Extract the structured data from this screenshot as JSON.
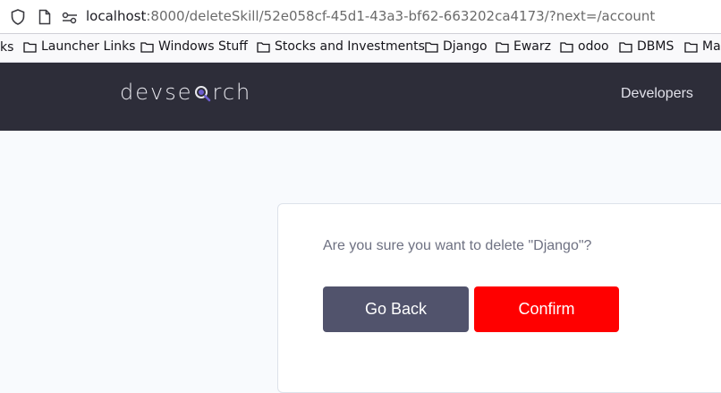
{
  "browser": {
    "url_host": "localhost",
    "url_rest": ":8000/deleteSkill/52e058cf-45d1-43a3-bf62-663202ca4173/?next=/account"
  },
  "bookmarks": {
    "lead_fragment": "ks",
    "items": [
      {
        "label": "Launcher Links"
      },
      {
        "label": "Windows Stuff"
      },
      {
        "label": "Stocks and Investments"
      },
      {
        "label": "Django"
      },
      {
        "label": "Ewarz"
      },
      {
        "label": "odoo"
      },
      {
        "label": "DBMS"
      },
      {
        "label": "Ma"
      }
    ]
  },
  "header": {
    "logo_prefix": "devse",
    "logo_suffix": "rch",
    "nav_developers": "Developers"
  },
  "dialog": {
    "question": "Are you sure you want to delete \"Django\"?",
    "back_label": "Go Back",
    "confirm_label": "Confirm"
  },
  "colors": {
    "header_bg": "#2d2d39",
    "back_button": "#51536c",
    "confirm_button": "#ff0000"
  }
}
